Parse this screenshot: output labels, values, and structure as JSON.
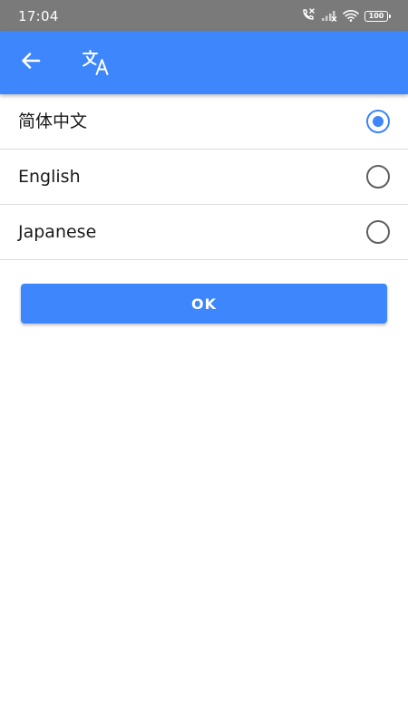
{
  "status_bar": {
    "time": "17:04",
    "battery_level": "100",
    "icons": [
      "call-missed-icon",
      "cellular-signal-off-icon",
      "wifi-icon",
      "battery-icon"
    ]
  },
  "app_bar": {
    "background_color": "#3d86fb",
    "icons": [
      "back-arrow-icon",
      "translate-icon"
    ]
  },
  "languages": [
    {
      "label": "简体中文",
      "selected": true
    },
    {
      "label": "English",
      "selected": false
    },
    {
      "label": "Japanese",
      "selected": false
    }
  ],
  "ok_button": {
    "label": "OK"
  },
  "colors": {
    "accent": "#3d86fb",
    "radio_unchecked": "#5f5f5f"
  }
}
